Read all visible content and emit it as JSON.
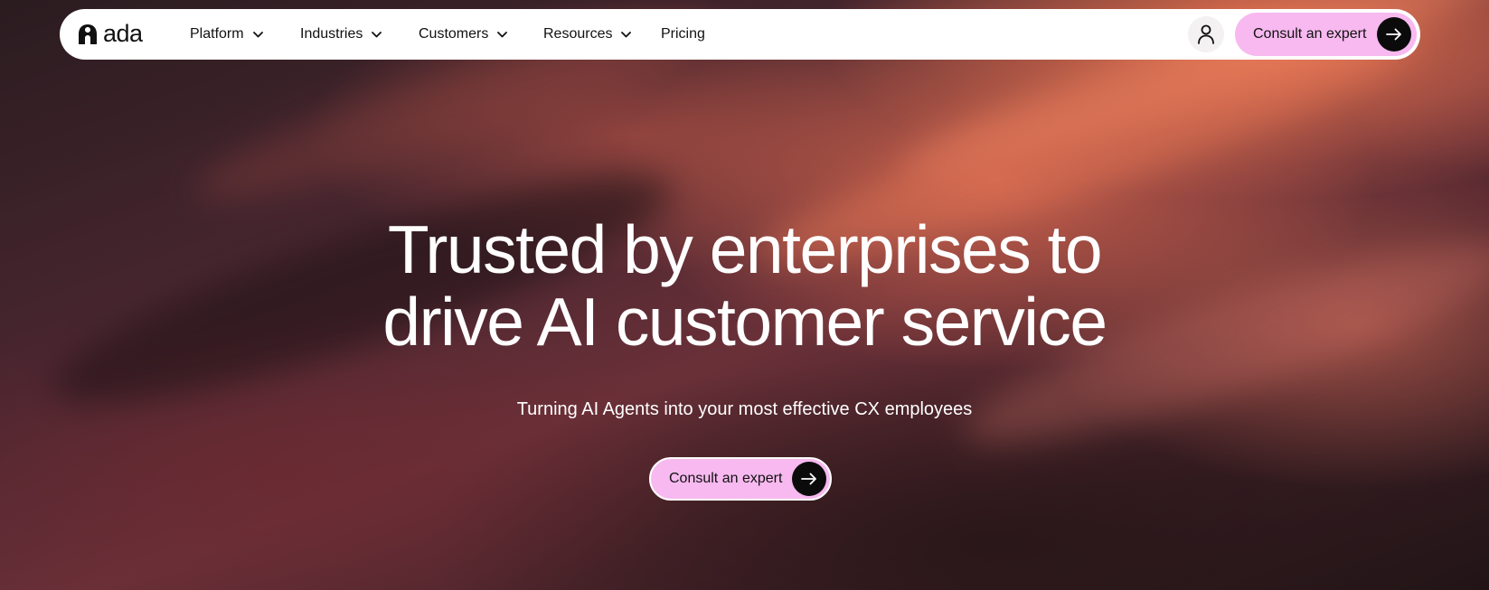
{
  "brand": {
    "name": "ada",
    "icon": "ada-logo-icon"
  },
  "nav": {
    "items": [
      {
        "label": "Platform",
        "icon": "chevron-down-icon"
      },
      {
        "label": "Industries",
        "icon": "chevron-down-icon"
      },
      {
        "label": "Customers",
        "icon": "chevron-down-icon"
      },
      {
        "label": "Resources",
        "icon": "chevron-down-icon"
      },
      {
        "label": "Pricing"
      }
    ],
    "account_icon": "user-icon",
    "cta_label": "Consult an expert",
    "cta_icon": "arrow-right-icon"
  },
  "hero": {
    "title_line1": "Trusted by enterprises to",
    "title_line2": "drive AI customer service",
    "subtitle": "Turning AI Agents into your most effective CX employees",
    "cta_label": "Consult an expert",
    "cta_icon": "arrow-right-icon"
  },
  "colors": {
    "cta_background": "#f7b9ef",
    "cta_arrow_background": "#0b0b0b",
    "nav_background": "#ffffff",
    "hero_text": "#ffffff",
    "accent_orange": "#e87856"
  }
}
